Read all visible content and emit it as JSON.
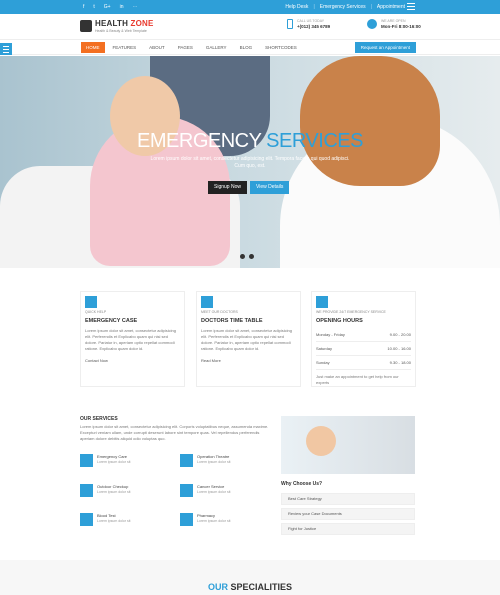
{
  "topbar": {
    "social": [
      "f",
      "t",
      "G+",
      "in",
      "⋯"
    ],
    "links": [
      "Help Desk",
      "Emergency Services",
      "Appointment"
    ]
  },
  "header": {
    "logo_brand": "HEALTH",
    "logo_brand_accent": "ZONE",
    "logo_sub": "Health & Beauty & Web Template",
    "call_label": "CALL US TODAY",
    "call_value": "+(012) 345 6789",
    "open_label": "WE ARE OPEN",
    "open_value": "Mon-Fri 8:00-16:00"
  },
  "nav": {
    "items": [
      "HOME",
      "FEATURES",
      "ABOUT",
      "PAGES",
      "GALLERY",
      "BLOG",
      "SHORTCODES"
    ],
    "appointment": "Request an Appointment"
  },
  "hero": {
    "title_a": "EMERGENCY",
    "title_b": "SERVICES",
    "subtitle": "Lorem ipsum dolor sit amet, consectetur adipisicing elit. Tempora facere qui quod adipisci. Cum quo, est.",
    "signup": "Signup Now",
    "details": "View Details"
  },
  "cards": [
    {
      "small": "QUICK HELP",
      "title": "EMERGENCY CASE",
      "text": "Lorem ipsum dolor sit amet, consectetur adipisicing elit. Perferendis et Explicabo quam qui nisi sed dolore. Pariatur in, aperiam optio repellat commodi ratione. Explicabo quam dolor id.",
      "more": "Contact Now"
    },
    {
      "small": "MEET OUR DOCTORS",
      "title": "DOCTORS TIME TABLE",
      "text": "Lorem ipsum dolor sit amet, consectetur adipisicing elit. Perferendis et Explicabo quam qui nisi sed dolore. Pariatur in, aperiam optio repellat commodi ratione. Explicabo quam dolor id.",
      "more": "Read More"
    },
    {
      "small": "WE PROVIDE 24/7 EMERGENCY SERVICE",
      "title": "OPENING HOURS",
      "hours": [
        [
          "Monday - Friday",
          "9.00 - 20.00"
        ],
        [
          "Saturday",
          "10.00 - 16.00"
        ],
        [
          "Sunday",
          "9.30 - 18.00"
        ]
      ],
      "text": "Just make an appointment to get help from our experts"
    }
  ],
  "services": {
    "title": "OUR SERVICES",
    "text": "Lorem ipsum dolor sit amet, consectetur adipisicing elit. Corporis voluptatibus neque, assumenda maxime. Excepturi veniam ullam, unde corrupti deserunt labore sint tempore quas. Vel repellendus perferendis aperiam dolore debitis aliquid odio voluptas quo.",
    "items": [
      {
        "name": "Emergency Care",
        "desc": "Lorem ipsum dolor sit"
      },
      {
        "name": "Operation Theatre",
        "desc": "Lorem ipsum dolor sit"
      },
      {
        "name": "Outdoor Checkup",
        "desc": "Lorem ipsum dolor sit"
      },
      {
        "name": "Cancer Service",
        "desc": "Lorem ipsum dolor sit"
      },
      {
        "name": "Blood Test",
        "desc": "Lorem ipsum dolor sit"
      },
      {
        "name": "Pharmacy",
        "desc": "Lorem ipsum dolor sit"
      }
    ]
  },
  "why": {
    "title": "Why Choose Us?",
    "items": [
      "Best Care Strategy",
      "Review your Case Documents",
      "Fight for Justice"
    ]
  },
  "specialities": {
    "a": "OUR",
    "b": "SPECIALITIES"
  },
  "colors": {
    "accent": "#2e9fd8",
    "nav_active": "#f36f21"
  }
}
